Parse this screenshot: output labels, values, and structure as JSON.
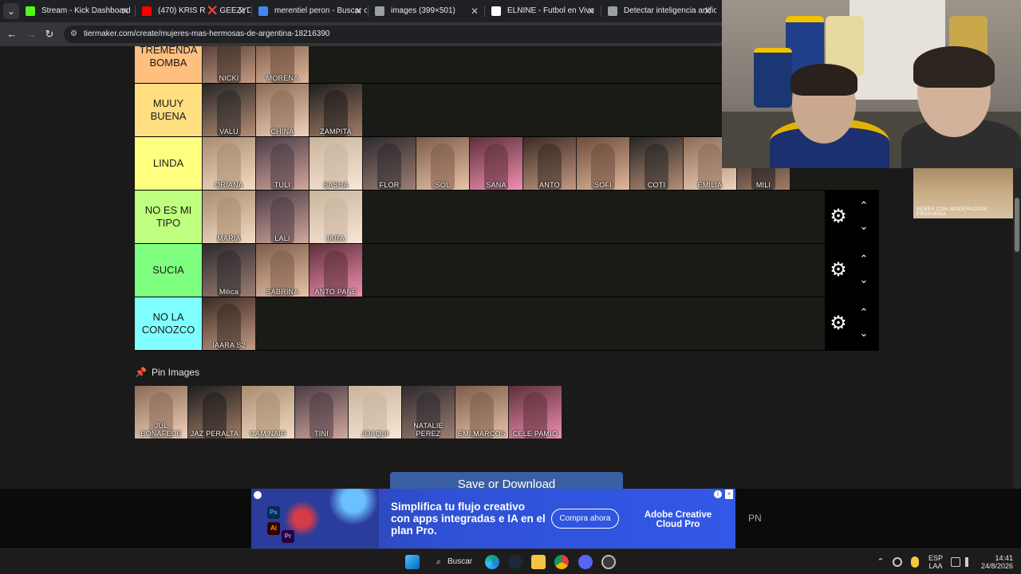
{
  "browser": {
    "tabs": [
      {
        "title": "Stream - Kick Dashboard",
        "icon_color": "#53fc18"
      },
      {
        "title": "(470) KRIS R ❌ GEEZYDEE",
        "icon_color": "#ff0000"
      },
      {
        "title": "merentiel peron - Buscar co",
        "icon_color": "#4285f4"
      },
      {
        "title": "images (399×501)",
        "icon_color": "#9aa0a6"
      },
      {
        "title": "ELNINE - Futbol en Vivo",
        "icon_color": "#ffffff"
      },
      {
        "title": "Detectar inteligencia artifici",
        "icon_color": "#9aa0a6"
      }
    ],
    "url": "tiermaker.com/create/mujeres-mas-hermosas-de-argentina-18216390"
  },
  "tiers": [
    {
      "label": "TREMENDA BOMBA",
      "color": "#ffbf7f",
      "items": [
        "NICKI",
        "MORENA"
      ],
      "controls": false
    },
    {
      "label": "MUUY BUENA",
      "color": "#ffdf7f",
      "items": [
        "VALU",
        "CHINA",
        "ZAMPITA"
      ],
      "controls": false
    },
    {
      "label": "LINDA",
      "color": "#ffff7f",
      "items": [
        "ORIANA",
        "TULI",
        "SASHA",
        "FLOR",
        "SOL",
        "SANA",
        "ANTO",
        "SOFI",
        "COTI",
        "EMILIA",
        "MILI"
      ],
      "controls": false
    },
    {
      "label": "NO ES MI TIPO",
      "color": "#bfff7f",
      "items": [
        "MARIA",
        "LALI",
        "IARA"
      ],
      "controls": true
    },
    {
      "label": "SUCIA",
      "color": "#7fff7f",
      "items": [
        "Milica",
        "SABRINA",
        "ANTO PANE"
      ],
      "controls": true
    },
    {
      "label": "NO LA CONOZCO",
      "color": "#7fffff",
      "items": [
        "IAARA S2"
      ],
      "controls": true
    }
  ],
  "pin_images": {
    "title": "Pin Images",
    "items": [
      "JUL BONAFEDE",
      "JAZ PERALTA",
      "CAM NAIR",
      "TINI",
      "JOAQUI",
      "NATALIE PEREZ",
      "EMI MARCOS",
      "CELE PAMIO"
    ]
  },
  "save_button": "Save or Download",
  "ad": {
    "headline": "Simplifica tu flujo creativo con apps integradas e IA en el plan Pro.",
    "cta": "Compra ahora",
    "brand": "Adobe Creative Cloud Pro",
    "info": "i",
    "close": "×",
    "apps": [
      "Ps",
      "Ai",
      "Pr"
    ]
  },
  "side_text": "PN",
  "side_ad_text": "BEBER CON MODERACIÓN. PROHIBIDA",
  "taskbar": {
    "search_label": "Buscar",
    "lang_line1": "ESP",
    "lang_line2": "LAA",
    "time": "14:41",
    "date": "24/8/2026"
  },
  "icons": {
    "gear": "⚙",
    "chevron_up": "⌃",
    "chevron_down": "⌄",
    "pin": "📌",
    "back": "←",
    "forward": "→",
    "reload": "↻",
    "site_settings": "⚙",
    "search": "⌕",
    "tab_menu": "⌄",
    "tab_close": "✕"
  }
}
